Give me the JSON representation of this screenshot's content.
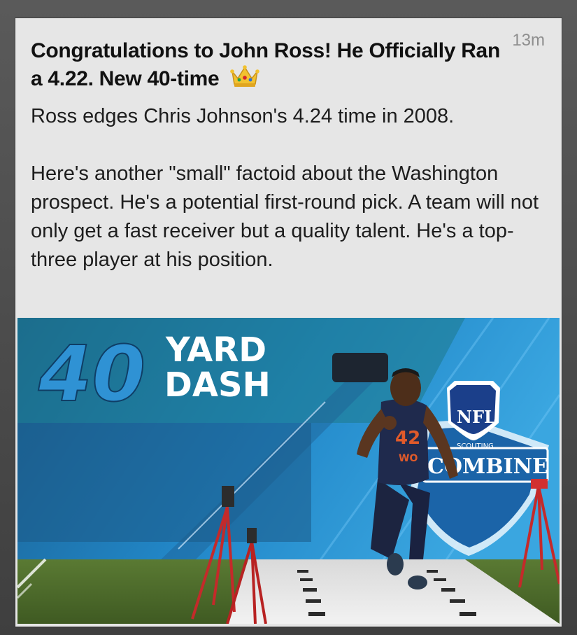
{
  "post": {
    "timestamp": "13m",
    "headline": "Congratulations to John Ross! He Officially Ran a 4.22. New 40-time",
    "headline_emoji": "crown-icon",
    "paragraph1": "Ross edges Chris Johnson's 4.24 time in 2008.",
    "paragraph2": "Here's another \"small\" factoid about the Washington prospect. He's a potential first-round pick. A team will not only get a fast receiver but a quality talent. He's a top-three player at his position."
  },
  "photo": {
    "banner_number": "40",
    "banner_line1": "YARD",
    "banner_line2": "DASH",
    "nfl_shield_text": "NFL",
    "combine_text_small": "SCOUTING",
    "combine_text": "COMBINE",
    "jersey_number": "42",
    "jersey_pos": "WO"
  },
  "colors": {
    "card_background": "#e6e6e6",
    "timestamp": "#8e8e8e",
    "banner_blue": "#2a8fd0",
    "turf_green": "#4f6b2c"
  }
}
